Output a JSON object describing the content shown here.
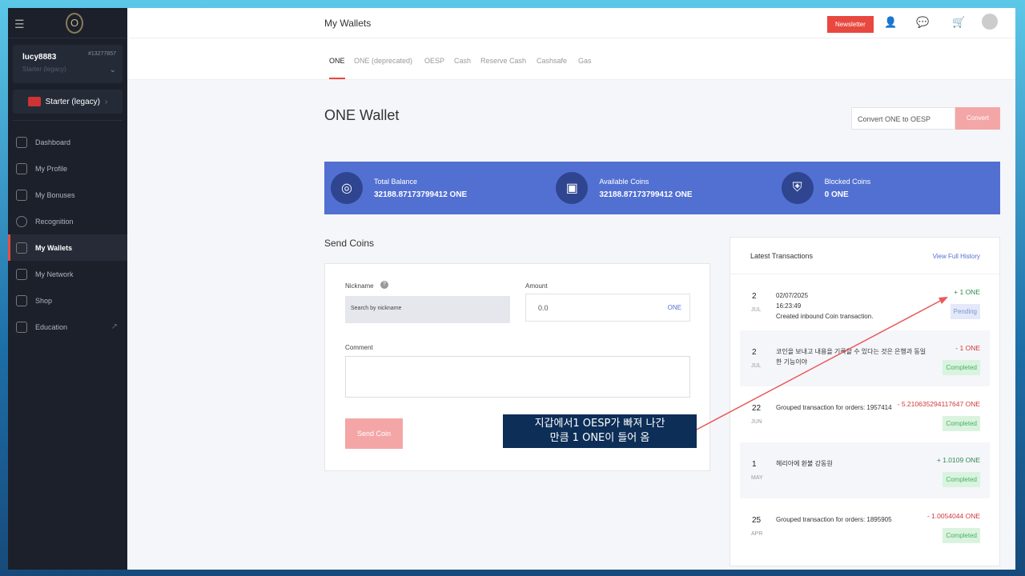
{
  "sidebar": {
    "user": "lucy8883",
    "user_id": "#13277857",
    "user_rank": "Starter (legacy)",
    "rank_button": "Starter (legacy)",
    "items": [
      {
        "label": "Dashboard"
      },
      {
        "label": "My Profile"
      },
      {
        "label": "My Bonuses"
      },
      {
        "label": "Recognition"
      },
      {
        "label": "My Wallets"
      },
      {
        "label": "My Network"
      },
      {
        "label": "Shop"
      },
      {
        "label": "Education"
      }
    ]
  },
  "header": {
    "title": "My Wallets",
    "newsletter": "Newsletter"
  },
  "tabs": [
    "ONE",
    "ONE (deprecated)",
    "OESP",
    "Cash",
    "Reserve Cash",
    "Cashsafe",
    "Gas"
  ],
  "wallet": {
    "title": "ONE Wallet",
    "convert_placeholder": "Convert ONE to OESP",
    "convert_button": "Convert",
    "total_label": "Total Balance",
    "total_value": "32188.87173799412 ONE",
    "available_label": "Available Coins",
    "available_value": "32188.87173799412 ONE",
    "blocked_label": "Blocked Coins",
    "blocked_value": "0 ONE"
  },
  "send": {
    "title": "Send Coins",
    "nickname_label": "Nickname",
    "nickname_placeholder": "Search by nickname",
    "amount_label": "Amount",
    "amount_value": "0.0",
    "amount_unit": "ONE",
    "comment_label": "Comment",
    "button": "Send Coin"
  },
  "transactions": {
    "title": "Latest Transactions",
    "link": "View Full History",
    "rows": [
      {
        "day": "2",
        "month": "JUL",
        "desc": "02/07/2025\n16:23:49\nCreated inbound Coin transaction.",
        "amount": "+ 1 ONE",
        "status": "Pending"
      },
      {
        "day": "2",
        "month": "JUL",
        "desc": "코인을 보내고 내용을 기록할 수 있다는 것은 은행과 동일한 기능이야",
        "amount": "- 1 ONE",
        "status": "Completed"
      },
      {
        "day": "22",
        "month": "JUN",
        "desc": "Grouped transaction for orders: 1957414",
        "amount": "- 5.210635294117647 ONE",
        "status": "Completed"
      },
      {
        "day": "1",
        "month": "MAY",
        "desc": "헤리아에 환불 강동원",
        "amount": "+ 1.0109 ONE",
        "status": "Completed"
      },
      {
        "day": "25",
        "month": "APR",
        "desc": "Grouped transaction for orders: 1895905",
        "amount": "- 1.0054044 ONE",
        "status": "Completed"
      }
    ]
  },
  "annotation": {
    "line1": "지갑에서1 OESP가 빠져 나간",
    "line2": "만큼 1 ONE이 들어 옴"
  }
}
